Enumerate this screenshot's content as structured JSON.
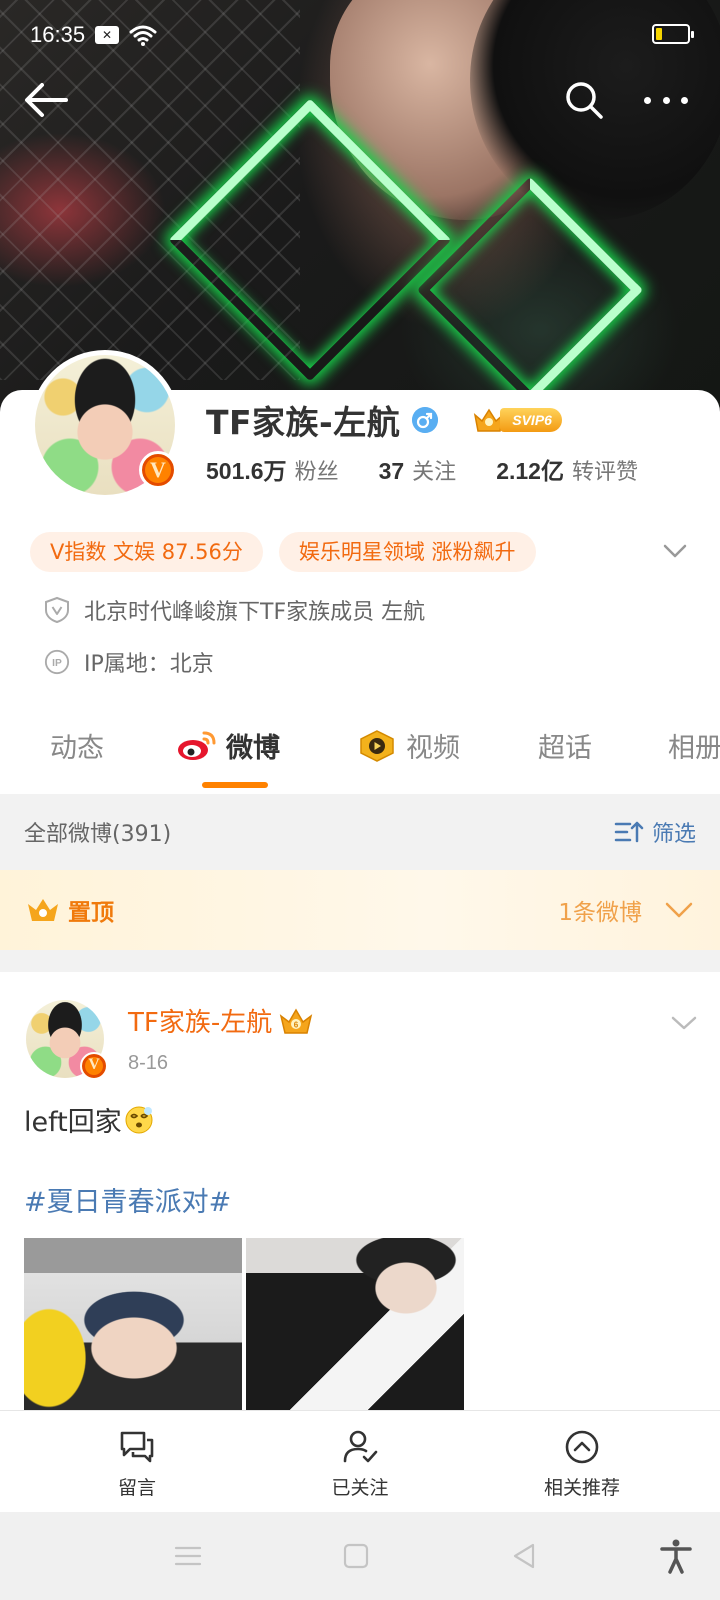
{
  "status_bar": {
    "time": "16:35",
    "sim_icon": "sim-x-icon",
    "wifi_icon": "wifi-icon",
    "battery_level": 0.2
  },
  "profile": {
    "name": "TF家族-左航",
    "gender": "male",
    "svip_label": "SVIP6",
    "stats": [
      {
        "value": "501.6万",
        "label": "粉丝"
      },
      {
        "value": "37",
        "label": "关注"
      },
      {
        "value": "2.12亿",
        "label": "转评赞"
      }
    ],
    "tags": [
      "V指数 文娱 87.56分",
      "娱乐明星领域 涨粉飙升"
    ],
    "verification": "北京时代峰峻旗下TF家族成员 左航",
    "ip_location": "IP属地：北京",
    "verified_badge": "V"
  },
  "tabs": [
    {
      "label": "动态",
      "active": false
    },
    {
      "label": "微博",
      "active": true
    },
    {
      "label": "视频",
      "active": false
    },
    {
      "label": "超话",
      "active": false
    },
    {
      "label": "相册",
      "active": false
    }
  ],
  "filter_bar": {
    "count_label": "全部微博(391)",
    "filter_label": "筛选"
  },
  "pinned": {
    "label": "置顶",
    "count_label": "1条微博"
  },
  "post": {
    "author": "TF家族-左航",
    "date": "8-16",
    "text": "left回家",
    "topic": "#夏日青春派对#",
    "emoji_icon": "dizzy-face-icon"
  },
  "action_bar": [
    {
      "label": "留言",
      "icon": "comment-icon"
    },
    {
      "label": "已关注",
      "icon": "user-followed-icon"
    },
    {
      "label": "相关推荐",
      "icon": "chevron-up-circle-icon"
    }
  ],
  "colors": {
    "accent": "#ff8200",
    "link": "#4a7ab3",
    "name_orange": "#f26a10"
  }
}
